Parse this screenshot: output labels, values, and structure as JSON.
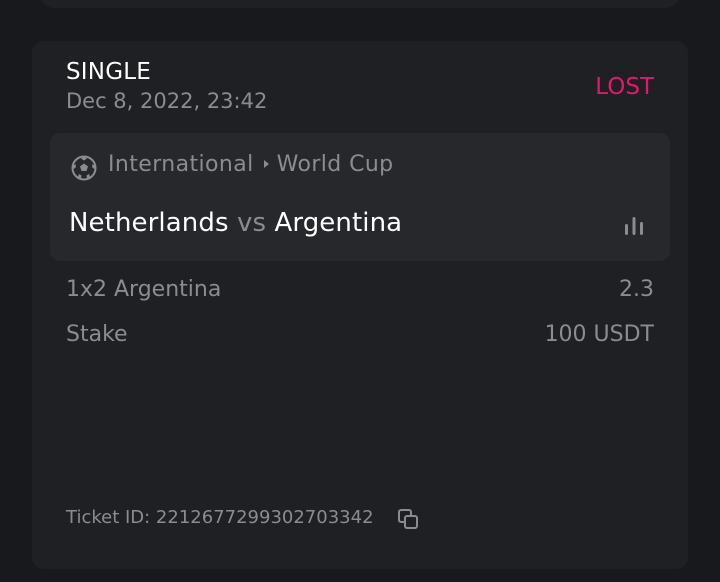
{
  "bet": {
    "type": "SINGLE",
    "date": "Dec 8, 2022, 23:42",
    "status": "LOST",
    "status_color": "#e4166d"
  },
  "event": {
    "sport_icon": "soccer-ball-icon",
    "category": "International",
    "league": "World Cup",
    "home_team": "Netherlands",
    "vs": "vs",
    "away_team": "Argentina",
    "stats_icon": "bar-chart-icon"
  },
  "selection": {
    "market": "1x2 Argentina",
    "odds": "2.3"
  },
  "stake": {
    "label": "Stake",
    "value": "100 USDT"
  },
  "ticket": {
    "label": "Ticket ID: 2212677299302703342",
    "copy_icon": "copy-icon"
  }
}
